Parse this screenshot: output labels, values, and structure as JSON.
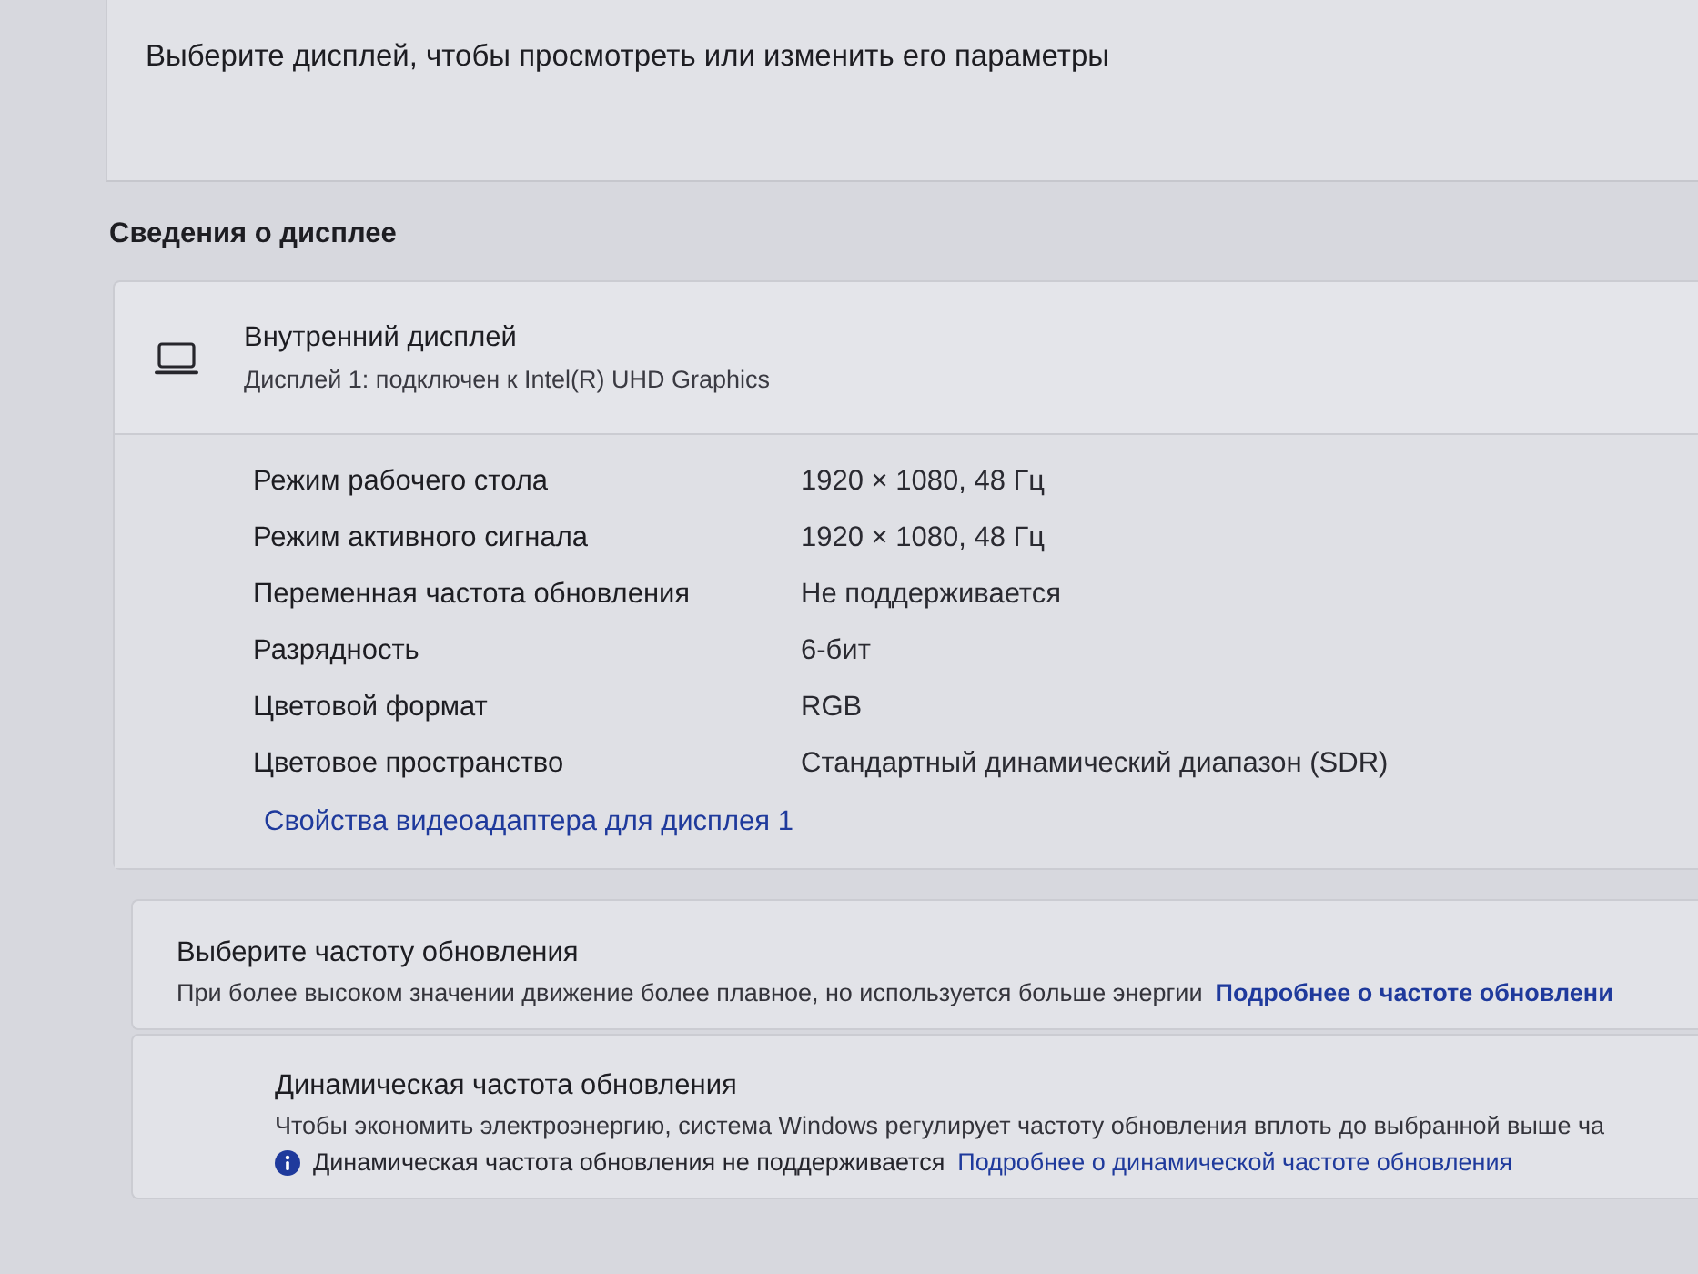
{
  "display_select": {
    "prompt": "Выберите дисплей, чтобы просмотреть или изменить его параметры"
  },
  "section_title": "Сведения о дисплее",
  "display_info": {
    "title": "Внутренний дисплей",
    "subtitle": "Дисплей 1: подключен к Intel(R) UHD Graphics",
    "properties": [
      {
        "label": "Режим рабочего стола",
        "value": "1920 × 1080, 48 Гц"
      },
      {
        "label": "Режим активного сигнала",
        "value": "1920 × 1080, 48 Гц"
      },
      {
        "label": "Переменная частота обновления",
        "value": "Не поддерживается"
      },
      {
        "label": "Разрядность",
        "value": "6-бит"
      },
      {
        "label": "Цветовой формат",
        "value": "RGB"
      },
      {
        "label": "Цветовое пространство",
        "value": "Стандартный динамический диапазон (SDR)"
      }
    ],
    "link": "Свойства видеоадаптера для дисплея 1"
  },
  "refresh_rate": {
    "title": "Выберите частоту обновления",
    "description": "При более высоком значении движение более плавное, но используется больше энергии",
    "link": "Подробнее о частоте обновлени"
  },
  "dynamic_refresh": {
    "title": "Динамическая частота обновления",
    "description": "Чтобы экономить электроэнергию, система Windows регулирует частоту обновления вплоть до выбранной выше ча",
    "notice": "Динамическая частота обновления не поддерживается",
    "link": "Подробнее о динамической частоте обновления"
  }
}
